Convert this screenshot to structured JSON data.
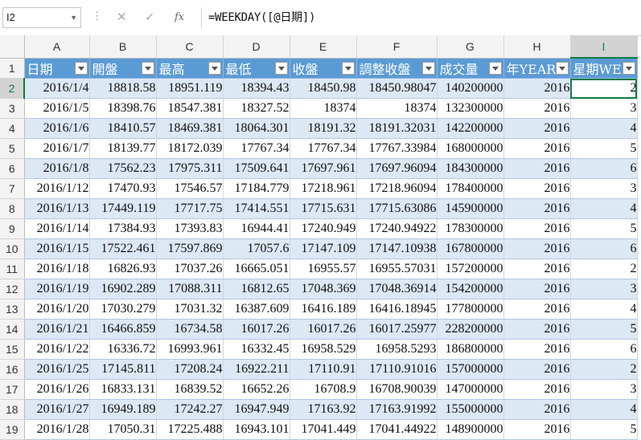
{
  "formula_bar": {
    "name_box": "I2",
    "cancel_icon": "✕",
    "enter_icon": "✓",
    "function_icon": "fx",
    "formula": "=WEEKDAY([@日期])"
  },
  "columns": [
    "A",
    "B",
    "C",
    "D",
    "E",
    "F",
    "G",
    "H",
    "I"
  ],
  "selected_column": "I",
  "header_row": {
    "row_number": "1",
    "headers": [
      "日期",
      "開盤",
      "最高",
      "最低",
      "收盤",
      "調整收盤",
      "成交量",
      "年YEAR",
      "星期WE"
    ]
  },
  "rows": [
    {
      "n": "2",
      "cells": [
        "2016/1/4",
        "18818.58",
        "18951.119",
        "18394.43",
        "18450.98",
        "18450.98047",
        "140200000",
        "2016",
        "2"
      ]
    },
    {
      "n": "3",
      "cells": [
        "2016/1/5",
        "18398.76",
        "18547.381",
        "18327.52",
        "18374",
        "18374",
        "132300000",
        "2016",
        "3"
      ]
    },
    {
      "n": "4",
      "cells": [
        "2016/1/6",
        "18410.57",
        "18469.381",
        "18064.301",
        "18191.32",
        "18191.32031",
        "142200000",
        "2016",
        "4"
      ]
    },
    {
      "n": "5",
      "cells": [
        "2016/1/7",
        "18139.77",
        "18172.039",
        "17767.34",
        "17767.34",
        "17767.33984",
        "168000000",
        "2016",
        "5"
      ]
    },
    {
      "n": "6",
      "cells": [
        "2016/1/8",
        "17562.23",
        "17975.311",
        "17509.641",
        "17697.961",
        "17697.96094",
        "184300000",
        "2016",
        "6"
      ]
    },
    {
      "n": "7",
      "cells": [
        "2016/1/12",
        "17470.93",
        "17546.57",
        "17184.779",
        "17218.961",
        "17218.96094",
        "178400000",
        "2016",
        "3"
      ]
    },
    {
      "n": "8",
      "cells": [
        "2016/1/13",
        "17449.119",
        "17717.75",
        "17414.551",
        "17715.631",
        "17715.63086",
        "145900000",
        "2016",
        "4"
      ]
    },
    {
      "n": "9",
      "cells": [
        "2016/1/14",
        "17384.93",
        "17393.83",
        "16944.41",
        "17240.949",
        "17240.94922",
        "178300000",
        "2016",
        "5"
      ]
    },
    {
      "n": "10",
      "cells": [
        "2016/1/15",
        "17522.461",
        "17597.869",
        "17057.6",
        "17147.109",
        "17147.10938",
        "167800000",
        "2016",
        "6"
      ]
    },
    {
      "n": "11",
      "cells": [
        "2016/1/18",
        "16826.93",
        "17037.26",
        "16665.051",
        "16955.57",
        "16955.57031",
        "157200000",
        "2016",
        "2"
      ]
    },
    {
      "n": "12",
      "cells": [
        "2016/1/19",
        "16902.289",
        "17088.311",
        "16812.65",
        "17048.369",
        "17048.36914",
        "154200000",
        "2016",
        "3"
      ]
    },
    {
      "n": "13",
      "cells": [
        "2016/1/20",
        "17030.279",
        "17031.32",
        "16387.609",
        "16416.189",
        "16416.18945",
        "177800000",
        "2016",
        "4"
      ]
    },
    {
      "n": "14",
      "cells": [
        "2016/1/21",
        "16466.859",
        "16734.58",
        "16017.26",
        "16017.26",
        "16017.25977",
        "228200000",
        "2016",
        "5"
      ]
    },
    {
      "n": "15",
      "cells": [
        "2016/1/22",
        "16336.72",
        "16993.961",
        "16332.45",
        "16958.529",
        "16958.5293",
        "186800000",
        "2016",
        "6"
      ]
    },
    {
      "n": "16",
      "cells": [
        "2016/1/25",
        "17145.811",
        "17208.24",
        "16922.211",
        "17110.91",
        "17110.91016",
        "157000000",
        "2016",
        "2"
      ]
    },
    {
      "n": "17",
      "cells": [
        "2016/1/26",
        "16833.131",
        "16839.52",
        "16652.26",
        "16708.9",
        "16708.90039",
        "147000000",
        "2016",
        "3"
      ]
    },
    {
      "n": "18",
      "cells": [
        "2016/1/27",
        "16949.189",
        "17242.27",
        "16947.949",
        "17163.92",
        "17163.91992",
        "155000000",
        "2016",
        "4"
      ]
    },
    {
      "n": "19",
      "cells": [
        "2016/1/28",
        "17050.31",
        "17225.488",
        "16943.101",
        "17041.449",
        "17041.44922",
        "148900000",
        "2016",
        "5"
      ]
    }
  ],
  "colors": {
    "table_header_bg": "#5b9bd5",
    "band_bg": "#dde8f5",
    "selection": "#107c41"
  }
}
